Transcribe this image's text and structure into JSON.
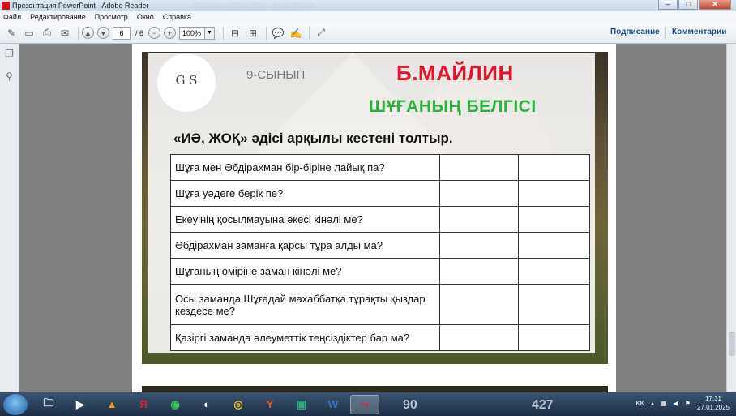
{
  "window": {
    "title": "Презентация PowerPoint - Adobe Reader",
    "ghost_title": "Презентация PowerPoint - Adobe Reader",
    "controls": {
      "minimize": "–",
      "maximize": "□",
      "close": "✕"
    }
  },
  "menu": [
    "Файл",
    "Редактирование",
    "Просмотр",
    "Окно",
    "Справка"
  ],
  "toolbar": {
    "page_current": "6",
    "page_total": "/ 6",
    "zoom": "100%",
    "sign_label": "Подписание",
    "comments_label": "Комментарии"
  },
  "slide": {
    "grade": "9-СЫНЫП",
    "author": "Б.МАЙЛИН",
    "subtitle": "ШҰҒАНЫҢ БЕЛГІСІ",
    "instruction": "«ИӘ, ЖОҚ» әдісі арқылы кестені толтыр.",
    "logo_monogram": "G S",
    "questions": [
      "Шұға мен Әбдірахман бір-біріне лайық па?",
      "Шұға уәдеге берік пе?",
      "Екеуінің қосылмауына әкесі кінәлі ме?",
      "Әбдірахман заманға қарсы тұра алды ма?",
      "Шұғаның өміріне заман кінәлі ме?",
      "Осы заманда Шұғадай махаббатқа тұрақты қыздар кездесе ме?",
      "Қазіргі заманда әлеуметтік теңсіздіктер бар ма?"
    ]
  },
  "taskbar": {
    "apps": [
      "explorer-icon",
      "media-player-icon",
      "vlc-icon",
      "yandex-icon",
      "whatsapp-icon",
      "photos-icon",
      "chrome-icon",
      "yandex-browser-icon",
      "kaspersky-icon",
      "word-icon",
      "adobe-reader-icon"
    ],
    "yandex_glyph": "Я",
    "word_glyph": "W",
    "num_left": "90",
    "num_right": "427",
    "lang": "KK",
    "time": "17:31",
    "date": "27.01.2025"
  }
}
